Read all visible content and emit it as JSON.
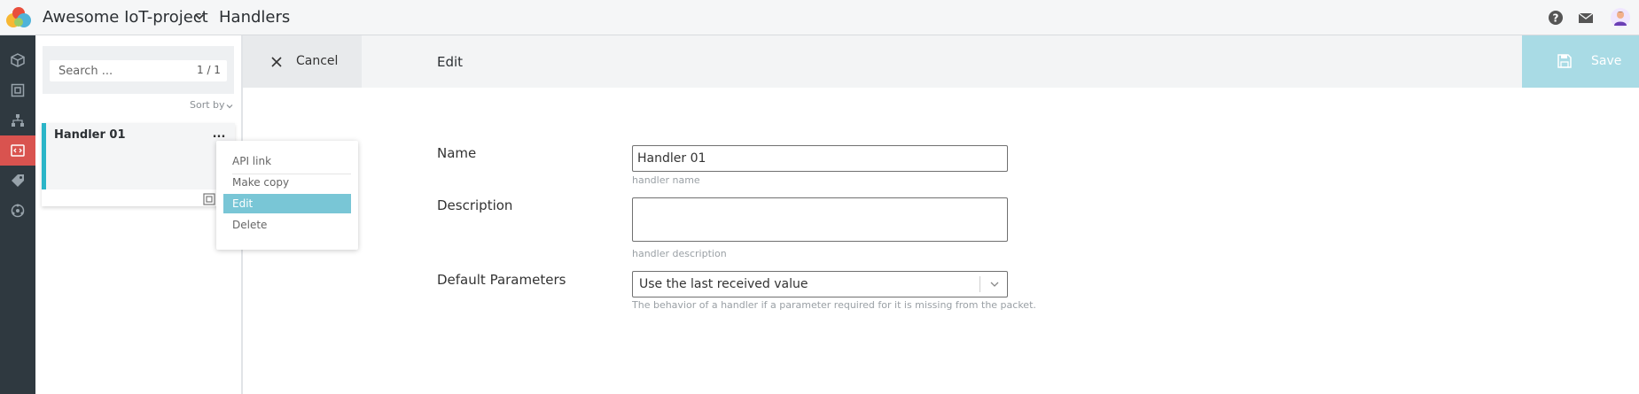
{
  "header": {
    "project_name": "Awesome IoT-project",
    "page_title": "Handlers"
  },
  "list": {
    "search": {
      "placeholder": "Search ...",
      "count": "1 / 1"
    },
    "sort_label": "Sort by",
    "items": [
      {
        "name": "Handler 01"
      }
    ],
    "more_label": "..."
  },
  "context_menu": {
    "items": [
      {
        "label": "API link"
      },
      {
        "label": "Make copy"
      },
      {
        "label": "Edit"
      },
      {
        "label": "Delete"
      }
    ],
    "highlighted": "Edit"
  },
  "toolbar": {
    "cancel_label": "Cancel",
    "title": "Edit",
    "save_label": "Save"
  },
  "form": {
    "name": {
      "label": "Name",
      "value": "Handler 01",
      "hint": "handler name"
    },
    "description": {
      "label": "Description",
      "value": "",
      "hint": "handler description"
    },
    "default_parameters": {
      "label": "Default Parameters",
      "value": "Use the last received value",
      "hint": "The behavior of a handler if a parameter required for it is missing from the packet."
    }
  },
  "colors": {
    "rail_bg": "#2f3940",
    "rail_active": "#d9534f",
    "accent": "#2bb5c8",
    "menu_highlight": "#79c6d6",
    "save_bg": "#a9dbe5"
  },
  "icons": {
    "rail": [
      "cube-icon",
      "device-icon",
      "hierarchy-icon",
      "code-icon",
      "tag-icon",
      "network-icon"
    ],
    "top_right": [
      "help-icon",
      "mail-icon",
      "user-avatar-icon"
    ]
  }
}
